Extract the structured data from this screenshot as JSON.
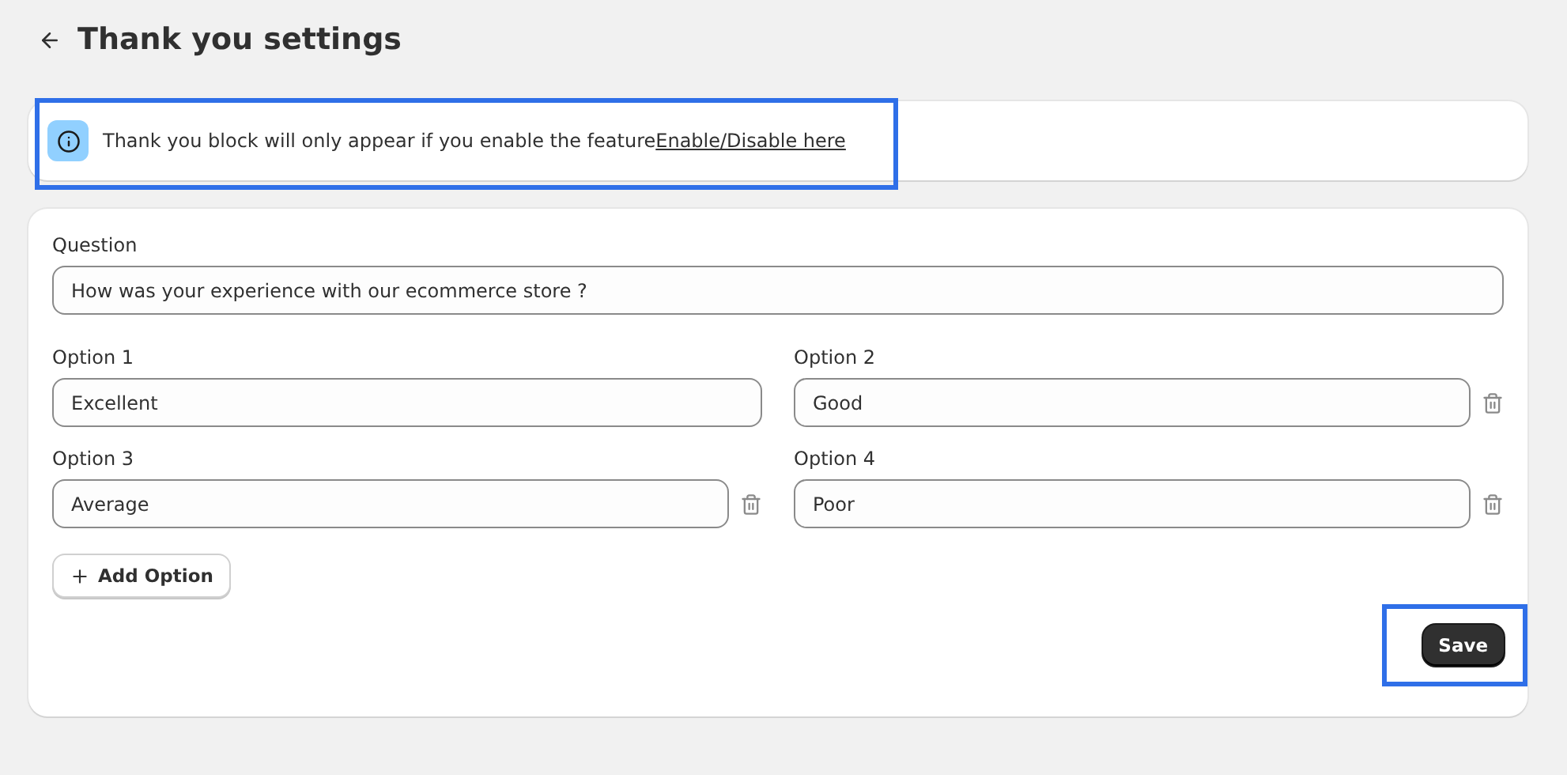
{
  "header": {
    "title": "Thank you settings"
  },
  "banner": {
    "text": "Thank you block will only appear if you enable the feature",
    "link": "Enable/Disable here",
    "highlighted": true
  },
  "question": {
    "label": "Question",
    "value": "How was your experience with our ecommerce store ?"
  },
  "options": [
    {
      "label": "Option 1",
      "value": "Excellent",
      "deletable": false
    },
    {
      "label": "Option 2",
      "value": "Good",
      "deletable": true
    },
    {
      "label": "Option 3",
      "value": "Average",
      "deletable": true
    },
    {
      "label": "Option 4",
      "value": "Poor",
      "deletable": true
    }
  ],
  "add_button": "Add Option",
  "save_button": {
    "label": "Save",
    "highlighted": true
  }
}
